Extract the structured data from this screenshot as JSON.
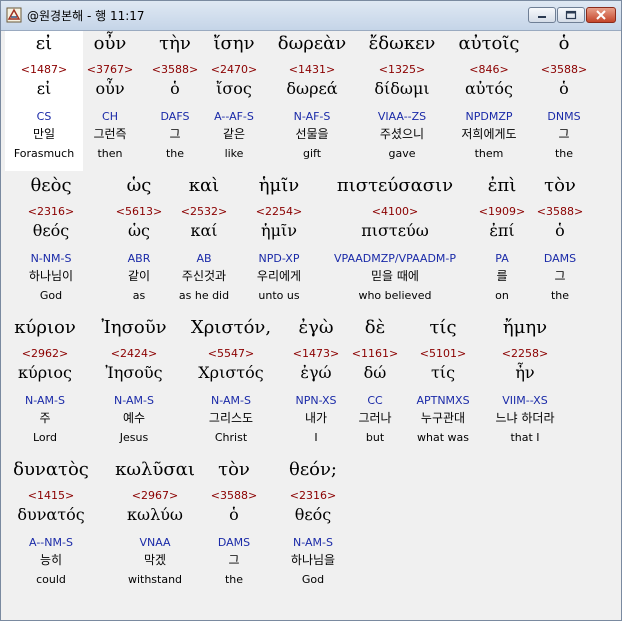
{
  "window": {
    "title": "@원경본해 - 행 11:17"
  },
  "words": [
    {
      "greek": "εἰ",
      "strong": "<1487>",
      "lemma": "εἰ",
      "morph": "CS",
      "korean": "만일",
      "english": "Forasmuch"
    },
    {
      "greek": "οὖν",
      "strong": "<3767>",
      "lemma": "οὖν",
      "morph": "CH",
      "korean": "그런즉",
      "english": "then"
    },
    {
      "greek": "τὴν",
      "strong": "<3588>",
      "lemma": "ὁ",
      "morph": "DAFS",
      "korean": "그",
      "english": "the"
    },
    {
      "greek": "ἴσην",
      "strong": "<2470>",
      "lemma": "ἴσος",
      "morph": "A--AF-S",
      "korean": "같은",
      "english": "like"
    },
    {
      "greek": "δωρεὰν",
      "strong": "<1431>",
      "lemma": "δωρεά",
      "morph": "N-AF-S",
      "korean": "선물을",
      "english": "gift"
    },
    {
      "greek": "ἔδωκεν",
      "strong": "<1325>",
      "lemma": "δίδωμι",
      "morph": "VIAA--ZS",
      "korean": "주셨으니",
      "english": "gave"
    },
    {
      "greek": "αὐτοῖς",
      "strong": "<846>",
      "lemma": "αὐτός",
      "morph": "NPDMZP",
      "korean": "저희에게도",
      "english": "them"
    },
    {
      "greek": "ὁ",
      "strong": "<3588>",
      "lemma": "ὁ",
      "morph": "DNMS",
      "korean": "그",
      "english": "the"
    },
    {
      "greek": "θεὸς",
      "strong": "<2316>",
      "lemma": "θεός",
      "morph": "N-NM-S",
      "korean": "하나님이",
      "english": "God"
    },
    {
      "greek": "ὡς",
      "strong": "<5613>",
      "lemma": "ὡς",
      "morph": "ABR",
      "korean": "같이",
      "english": "as"
    },
    {
      "greek": "καὶ",
      "strong": "<2532>",
      "lemma": "καί",
      "morph": "AB",
      "korean": "주신것과",
      "english": "as he did"
    },
    {
      "greek": "ἡμῖν",
      "strong": "<2254>",
      "lemma": "ἡμῖν",
      "morph": "NPD-XP",
      "korean": "우리에게",
      "english": "unto us"
    },
    {
      "greek": "πιστεύσασιν",
      "strong": "<4100>",
      "lemma": "πιστεύω",
      "morph": "VPAADMZP/VPAADM-P",
      "korean": "믿을 때에",
      "english": "who believed"
    },
    {
      "greek": "ἐπὶ",
      "strong": "<1909>",
      "lemma": "ἐπί",
      "morph": "PA",
      "korean": "를",
      "english": "on"
    },
    {
      "greek": "τὸν",
      "strong": "<3588>",
      "lemma": "ὁ",
      "morph": "DAMS",
      "korean": "그",
      "english": "the"
    },
    {
      "greek": "κύριον",
      "strong": "<2962>",
      "lemma": "κύριος",
      "morph": "N-AM-S",
      "korean": "주",
      "english": "Lord"
    },
    {
      "greek": "Ἰησοῦν",
      "strong": "<2424>",
      "lemma": "Ἰησοῦς",
      "morph": "N-AM-S",
      "korean": "예수",
      "english": "Jesus"
    },
    {
      "greek": "Χριστόν,",
      "strong": "<5547>",
      "lemma": "Χριστός",
      "morph": "N-AM-S",
      "korean": "그리스도",
      "english": "Christ"
    },
    {
      "greek": "ἐγὼ",
      "strong": "<1473>",
      "lemma": "ἐγώ",
      "morph": "NPN-XS",
      "korean": "내가",
      "english": "I"
    },
    {
      "greek": "δὲ",
      "strong": "<1161>",
      "lemma": "δώ",
      "morph": "CC",
      "korean": "그러나",
      "english": "but"
    },
    {
      "greek": "τίς",
      "strong": "<5101>",
      "lemma": "τίς",
      "morph": "APTNMXS",
      "korean": "누구관대",
      "english": "what was"
    },
    {
      "greek": "ἤμην",
      "strong": "<2258>",
      "lemma": "ἦν",
      "morph": "VIIM--XS",
      "korean": "느냐 하더라",
      "english": "that I"
    },
    {
      "greek": "δυνατὸς",
      "strong": "<1415>",
      "lemma": "δυνατός",
      "morph": "A--NM-S",
      "korean": "능히",
      "english": "could"
    },
    {
      "greek": "κωλῦσαι",
      "strong": "<2967>",
      "lemma": "κωλύω",
      "morph": "VNAA",
      "korean": "막겠",
      "english": "withstand"
    },
    {
      "greek": "τὸν",
      "strong": "<3588>",
      "lemma": "ὁ",
      "morph": "DAMS",
      "korean": "그",
      "english": "the"
    },
    {
      "greek": "θεόν;",
      "strong": "<2316>",
      "lemma": "θεός",
      "morph": "N-AM-S",
      "korean": "하나님을",
      "english": "God"
    }
  ],
  "colors": {
    "strong": "#8b0000",
    "morph": "#1a2aa8",
    "titlebar": "#c5d5e8",
    "selected": "#ffffff"
  },
  "icons": [
    "app-icon",
    "minimize-icon",
    "maximize-icon",
    "close-icon"
  ]
}
